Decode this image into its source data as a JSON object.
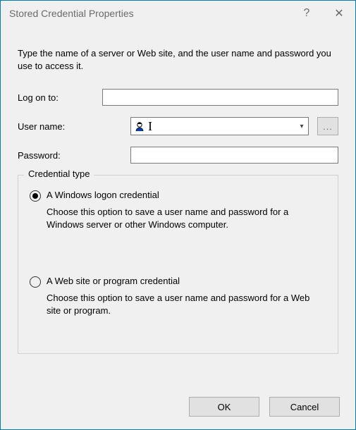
{
  "window": {
    "title": "Stored Credential Properties",
    "help_icon": "?",
    "close_icon": "✕"
  },
  "instruction": "Type the name of a server or Web site, and the user name and password you use to access it.",
  "fields": {
    "logon_to": {
      "label": "Log on to:",
      "value": ""
    },
    "username": {
      "label": "User name:",
      "value": "",
      "caret_text": "I",
      "icon": "user-icon",
      "browse_label": "..."
    },
    "password": {
      "label": "Password:",
      "value": ""
    }
  },
  "group": {
    "legend": "Credential type",
    "options": {
      "windows": {
        "title": "A Windows logon credential",
        "desc": "Choose this option to save a user name and password for a Windows server or other Windows computer.",
        "selected": true
      },
      "website": {
        "title": "A Web site or program credential",
        "desc": "Choose this option to save a user name and password for a Web site or program.",
        "selected": false
      }
    }
  },
  "buttons": {
    "ok": "OK",
    "cancel": "Cancel"
  }
}
